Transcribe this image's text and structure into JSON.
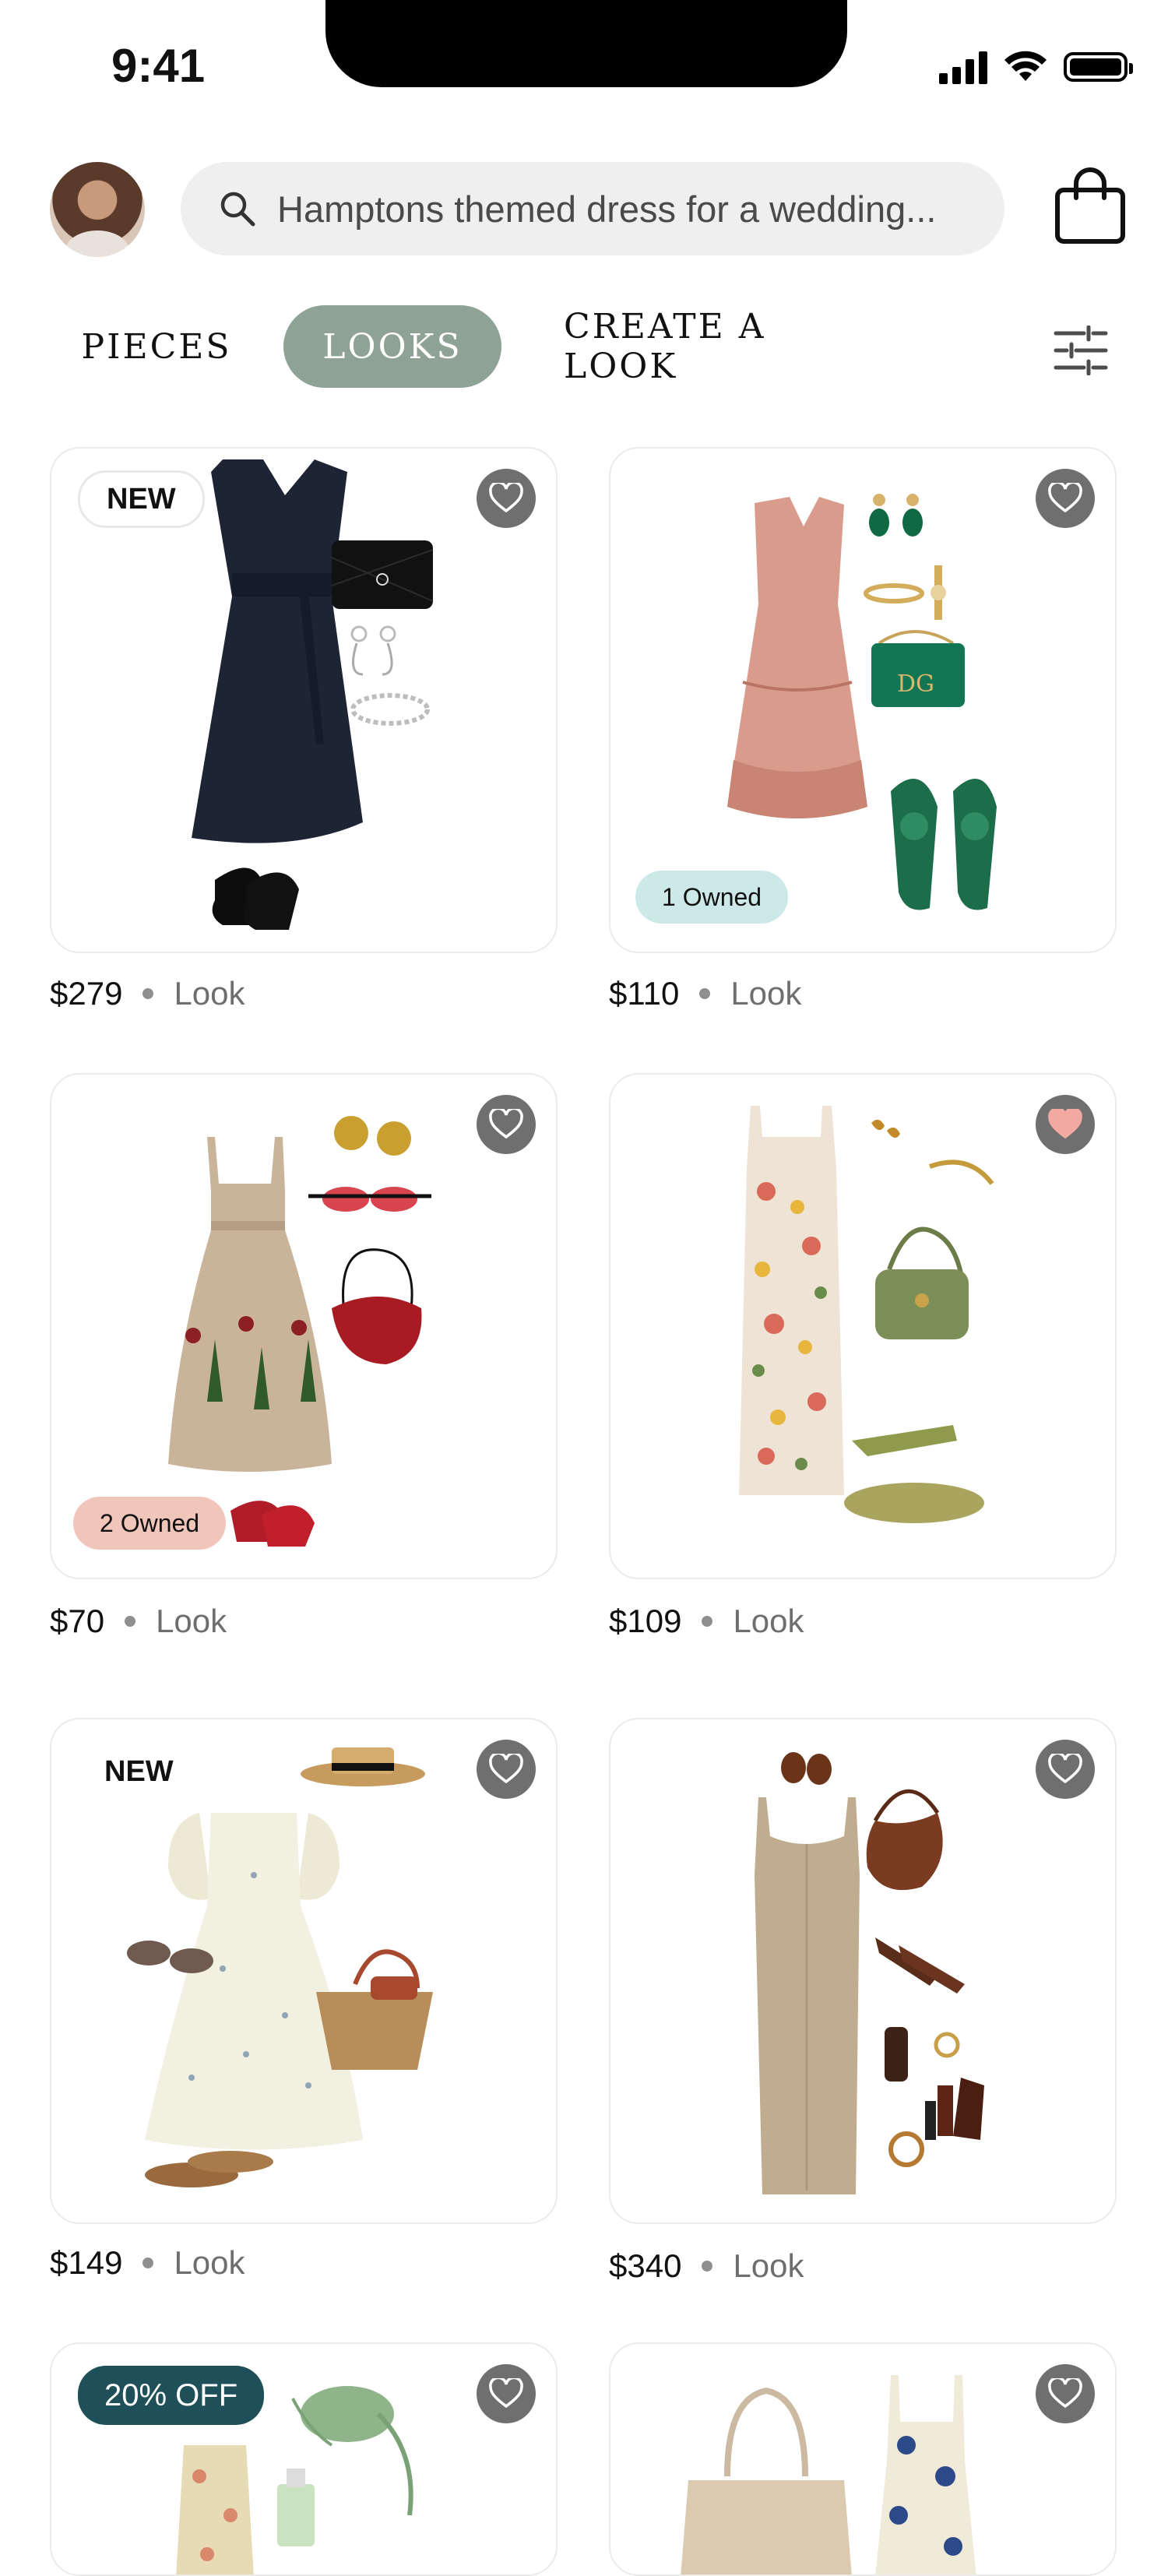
{
  "status": {
    "time": "9:41"
  },
  "search": {
    "query": "Hamptons themed dress for a wedding..."
  },
  "tabs": [
    {
      "label": "PIECES",
      "active": false
    },
    {
      "label": "LOOKS",
      "active": true
    },
    {
      "label": "CREATE A LOOK",
      "active": false
    }
  ],
  "icons": {
    "search": "search-icon",
    "bag": "shopping-bag-icon",
    "filter": "filter-sliders-icon",
    "favorite": "heart-icon"
  },
  "colors": {
    "active_tab": "#8ea295",
    "heart_button": "#6f6f6f",
    "heart_favorited": "#f1a9a2",
    "owned_teal": "#cce9e7",
    "owned_pink": "#f1c6ba",
    "discount_badge": "#1f5059"
  },
  "looks": [
    {
      "price": "$279",
      "kind": "Look",
      "badge": "NEW",
      "favorited": false
    },
    {
      "price": "$110",
      "kind": "Look",
      "badge": "1 Owned",
      "favorited": false
    },
    {
      "price": "$70",
      "kind": "Look",
      "badge": "2 Owned",
      "favorited": false
    },
    {
      "price": "$109",
      "kind": "Look",
      "badge": "",
      "favorited": true
    },
    {
      "price": "$149",
      "kind": "Look",
      "badge": "NEW",
      "favorited": false
    },
    {
      "price": "$340",
      "kind": "Look",
      "badge": "",
      "favorited": false
    },
    {
      "price": "",
      "kind": "",
      "badge": "20% OFF",
      "favorited": false
    },
    {
      "price": "",
      "kind": "",
      "badge": "",
      "favorited": false
    }
  ]
}
